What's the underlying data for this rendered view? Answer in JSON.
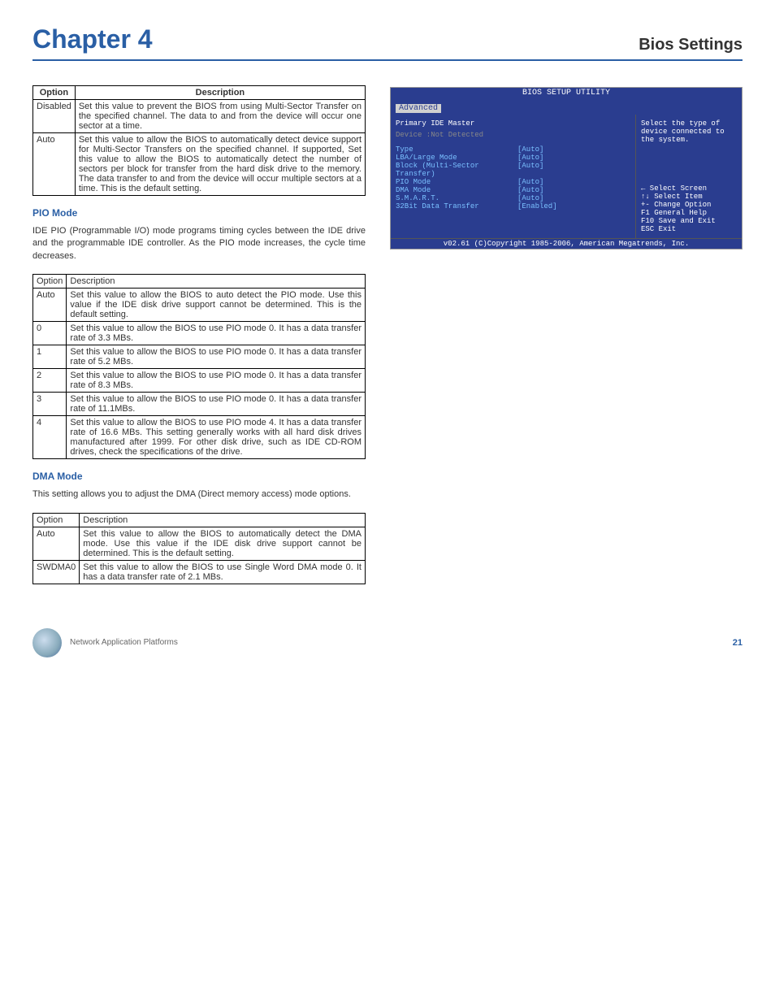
{
  "header": {
    "chapter": "Chapter 4",
    "section": "Bios Settings"
  },
  "table1": {
    "head": {
      "c1": "Option",
      "c2": "Description"
    },
    "rows": [
      {
        "opt": "Disabled",
        "desc": "Set this value to prevent the BIOS from using Multi-Sector Transfer on the specified channel. The data to and from the device will occur one sector at a time."
      },
      {
        "opt": "Auto",
        "desc": "Set this value to allow the BIOS to automatically detect device support for Multi-Sector Transfers on the specified channel. If supported, Set this value to allow the BIOS to automatically detect the number of sectors per block for transfer from the hard disk drive to the memory. The data transfer to and from the device will occur multiple sectors at a time. This is the default setting."
      }
    ]
  },
  "pio": {
    "title": "PIO Mode",
    "body": "IDE PIO (Programmable I/O) mode programs timing cycles between the IDE drive and the programmable IDE controller. As the PIO mode increases, the cycle time decreases.",
    "head": {
      "c1": "Option",
      "c2": "Description"
    },
    "rows": [
      {
        "opt": "Auto",
        "desc": "Set this value to allow the BIOS to auto detect the PIO mode. Use this value if the IDE disk drive support cannot be determined. This is the default setting."
      },
      {
        "opt": "0",
        "desc": "Set this value to allow the BIOS to use PIO mode 0. It has a data transfer rate of 3.3 MBs."
      },
      {
        "opt": "1",
        "desc": "Set this value to allow the BIOS to use PIO mode 0. It has a data transfer rate of 5.2 MBs."
      },
      {
        "opt": "2",
        "desc": "Set this value to allow the BIOS to use PIO mode 0. It has a data transfer rate of 8.3 MBs."
      },
      {
        "opt": "3",
        "desc": "Set this value to allow the BIOS to use PIO mode 0. It has a data transfer rate of 11.1MBs."
      },
      {
        "opt": "4",
        "desc": "Set this value to allow the BIOS to use PIO mode 4. It has a data transfer rate of 16.6 MBs. This setting generally works with all hard disk drives manufactured after 1999. For other disk drive, such as IDE CD-ROM drives, check the specifications of the drive."
      }
    ]
  },
  "dma": {
    "title": "DMA Mode",
    "body": "This setting allows you to adjust the DMA (Direct memory access) mode options.",
    "head": {
      "c1": "Option",
      "c2": "Description"
    },
    "rows": [
      {
        "opt": "Auto",
        "desc": "Set this value to allow the BIOS to automatically detect the DMA mode. Use this value if the IDE disk drive support cannot be determined. This is the default setting."
      },
      {
        "opt": "SWDMA0",
        "desc": "Set this value to allow the BIOS to use Single Word DMA mode 0. It has a data transfer rate of 2.1 MBs."
      }
    ]
  },
  "bios": {
    "title": "BIOS SETUP UTILITY",
    "tab": "Advanced",
    "hdr": "Primary IDE Master",
    "dev": "Device   :Not Detected",
    "opts": [
      {
        "lbl": "Type",
        "val": "[Auto]"
      },
      {
        "lbl": "LBA/Large Mode",
        "val": "[Auto]"
      },
      {
        "lbl": "Block (Multi-Sector Transfer)",
        "val": "[Auto]"
      },
      {
        "lbl": "PIO Mode",
        "val": "[Auto]"
      },
      {
        "lbl": "DMA Mode",
        "val": "[Auto]"
      },
      {
        "lbl": "S.M.A.R.T.",
        "val": "[Auto]"
      },
      {
        "lbl": "32Bit Data Transfer",
        "val": "[Enabled]"
      }
    ],
    "right_top": "Select the type of device connected to the system.",
    "help": [
      "←    Select Screen",
      "↑↓   Select Item",
      "+-   Change Option",
      "F1   General Help",
      "F10  Save and Exit",
      "ESC  Exit"
    ],
    "foot": "v02.61 (C)Copyright 1985-2006, American Megatrends, Inc."
  },
  "footer": {
    "text": "Network Application Platforms",
    "page": "21"
  }
}
